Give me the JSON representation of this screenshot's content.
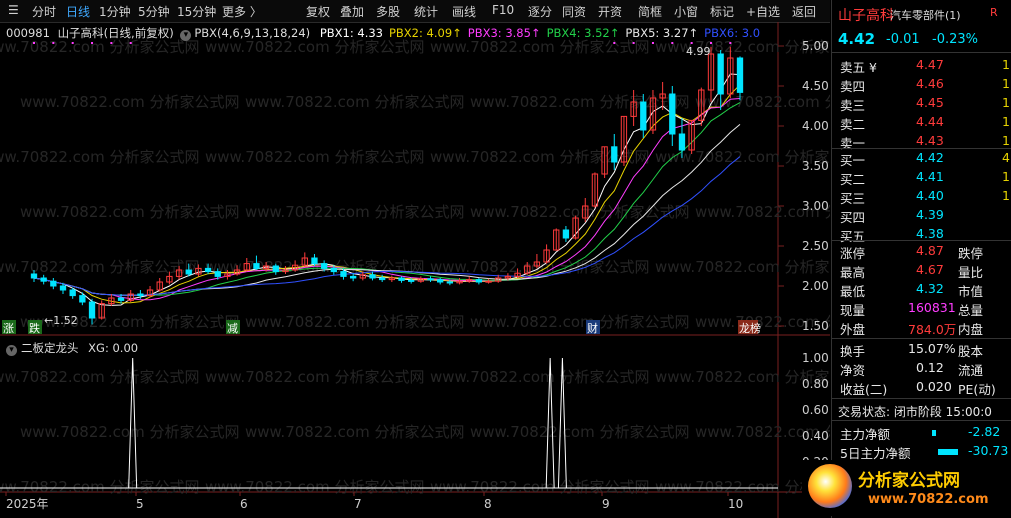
{
  "toolbar": {
    "left_items": [
      "分时",
      "日线",
      "1分钟",
      "5分钟",
      "15分钟",
      "更多 〉"
    ],
    "active": "日线",
    "right_items": [
      "复权",
      "叠加",
      "多股",
      "统计",
      "画线",
      "F10",
      "逐分",
      "同资",
      "开资",
      "简框",
      "小窗",
      "标记",
      "+自选",
      "返回"
    ]
  },
  "stock": {
    "code": "000981",
    "name": "山子高科",
    "period_label": "(日线,前复权)",
    "industry": "汽车零部件(1)",
    "indicator": "PBX(4,6,9,13,18,24)",
    "pbx": [
      {
        "label": "PBX1: 4.33",
        "color": "#ffffff"
      },
      {
        "label": "PBX2: 4.09↑",
        "color": "#e6d200"
      },
      {
        "label": "PBX3: 3.85↑",
        "color": "#ff3dff"
      },
      {
        "label": "PBX4: 3.52↑",
        "color": "#22d04a"
      },
      {
        "label": "PBX5: 3.27↑",
        "color": "#e8e8e8"
      },
      {
        "label": "PBX6: 3.0",
        "color": "#3050ff"
      }
    ],
    "watermark": "www.70822.com 分析家公式网"
  },
  "price_axis": [
    "5.00",
    "4.50",
    "4.00",
    "3.50",
    "3.00",
    "2.50",
    "2.00",
    "1.50"
  ],
  "annotations": {
    "high": "4.99",
    "low": "←1.52"
  },
  "markers": [
    "涨",
    "跌",
    "减",
    "财",
    "龙榜"
  ],
  "sub_indicator": {
    "title": "二板定龙头",
    "value_label": "XG: 0.00",
    "axis": [
      "1.00",
      "0.80",
      "0.60",
      "0.40",
      "0.20"
    ]
  },
  "chart_data": {
    "type": "candlestick",
    "ylim": [
      1.4,
      5.1
    ],
    "x_labels": [
      "2025年",
      "5",
      "6",
      "7",
      "8",
      "9",
      "10"
    ],
    "candles": [
      [
        2.15,
        2.1,
        2.2,
        2.05
      ],
      [
        2.1,
        2.06,
        2.14,
        2.02
      ],
      [
        2.06,
        2.0,
        2.1,
        1.96
      ],
      [
        2.0,
        1.95,
        2.04,
        1.9
      ],
      [
        1.95,
        1.88,
        1.98,
        1.84
      ],
      [
        1.88,
        1.8,
        1.92,
        1.76
      ],
      [
        1.8,
        1.6,
        1.84,
        1.52
      ],
      [
        1.6,
        1.78,
        1.82,
        1.58
      ],
      [
        1.78,
        1.85,
        1.9,
        1.75
      ],
      [
        1.85,
        1.82,
        1.9,
        1.78
      ],
      [
        1.82,
        1.9,
        1.95,
        1.8
      ],
      [
        1.9,
        1.88,
        1.95,
        1.84
      ],
      [
        1.88,
        1.95,
        2.0,
        1.86
      ],
      [
        1.95,
        2.05,
        2.1,
        1.93
      ],
      [
        2.05,
        2.12,
        2.18,
        2.02
      ],
      [
        2.12,
        2.2,
        2.25,
        2.08
      ],
      [
        2.2,
        2.15,
        2.28,
        2.12
      ],
      [
        2.15,
        2.22,
        2.27,
        2.12
      ],
      [
        2.22,
        2.18,
        2.28,
        2.15
      ],
      [
        2.18,
        2.12,
        2.22,
        2.08
      ],
      [
        2.12,
        2.15,
        2.2,
        2.08
      ],
      [
        2.15,
        2.2,
        2.26,
        2.13
      ],
      [
        2.2,
        2.28,
        2.35,
        2.18
      ],
      [
        2.28,
        2.22,
        2.38,
        2.2
      ],
      [
        2.22,
        2.25,
        2.3,
        2.18
      ],
      [
        2.25,
        2.18,
        2.28,
        2.14
      ],
      [
        2.18,
        2.2,
        2.25,
        2.15
      ],
      [
        2.2,
        2.26,
        2.32,
        2.18
      ],
      [
        2.26,
        2.35,
        2.42,
        2.24
      ],
      [
        2.35,
        2.28,
        2.4,
        2.25
      ],
      [
        2.28,
        2.22,
        2.32,
        2.18
      ],
      [
        2.22,
        2.18,
        2.26,
        2.14
      ],
      [
        2.18,
        2.12,
        2.22,
        2.08
      ],
      [
        2.12,
        2.1,
        2.16,
        2.06
      ],
      [
        2.1,
        2.14,
        2.18,
        2.07
      ],
      [
        2.14,
        2.1,
        2.18,
        2.07
      ],
      [
        2.1,
        2.08,
        2.14,
        2.05
      ],
      [
        2.08,
        2.1,
        2.13,
        2.05
      ],
      [
        2.1,
        2.07,
        2.12,
        2.04
      ],
      [
        2.07,
        2.06,
        2.1,
        2.03
      ],
      [
        2.06,
        2.09,
        2.12,
        2.04
      ],
      [
        2.09,
        2.08,
        2.12,
        2.05
      ],
      [
        2.08,
        2.05,
        2.1,
        2.02
      ],
      [
        2.05,
        2.04,
        2.08,
        2.01
      ],
      [
        2.04,
        2.06,
        2.1,
        2.02
      ],
      [
        2.06,
        2.08,
        2.12,
        2.04
      ],
      [
        2.08,
        2.05,
        2.1,
        2.02
      ],
      [
        2.05,
        2.06,
        2.09,
        2.03
      ],
      [
        2.06,
        2.1,
        2.14,
        2.04
      ],
      [
        2.1,
        2.12,
        2.16,
        2.07
      ],
      [
        2.12,
        2.16,
        2.22,
        2.1
      ],
      [
        2.16,
        2.25,
        2.3,
        2.14
      ],
      [
        2.25,
        2.3,
        2.4,
        2.22
      ],
      [
        2.3,
        2.45,
        2.52,
        2.28
      ],
      [
        2.45,
        2.7,
        2.72,
        2.44
      ],
      [
        2.7,
        2.6,
        2.75,
        2.55
      ],
      [
        2.6,
        2.85,
        2.88,
        2.58
      ],
      [
        2.85,
        3.0,
        3.1,
        2.8
      ],
      [
        3.0,
        3.4,
        3.42,
        2.98
      ],
      [
        3.4,
        3.74,
        3.74,
        3.35
      ],
      [
        3.74,
        3.55,
        3.9,
        3.45
      ],
      [
        3.55,
        4.12,
        4.12,
        3.5
      ],
      [
        4.12,
        4.3,
        4.45,
        4.0
      ],
      [
        4.3,
        3.95,
        4.4,
        3.85
      ],
      [
        3.95,
        4.35,
        4.45,
        3.9
      ],
      [
        4.35,
        4.4,
        4.55,
        4.2
      ],
      [
        4.4,
        3.9,
        4.5,
        3.75
      ],
      [
        3.9,
        3.7,
        4.1,
        3.6
      ],
      [
        3.7,
        4.07,
        4.07,
        3.65
      ],
      [
        4.07,
        4.45,
        4.48,
        4.0
      ],
      [
        4.45,
        4.9,
        4.99,
        4.3
      ],
      [
        4.9,
        4.4,
        4.95,
        4.2
      ],
      [
        4.4,
        4.85,
        4.99,
        4.35
      ],
      [
        4.85,
        4.42,
        4.87,
        4.32
      ]
    ],
    "xg_peaks": [
      0.168,
      0.713,
      0.729
    ]
  },
  "quote": {
    "price": "4.42",
    "change": "-0.01",
    "change_pct": "-0.23%",
    "asks": [
      {
        "label": "卖五 ¥",
        "price": "4.47",
        "vol": "1"
      },
      {
        "label": "卖四",
        "price": "4.46",
        "vol": "1"
      },
      {
        "label": "卖三",
        "price": "4.45",
        "vol": "1"
      },
      {
        "label": "卖二",
        "price": "4.44",
        "vol": "1"
      },
      {
        "label": "卖一",
        "price": "4.43",
        "vol": "1"
      }
    ],
    "bids": [
      {
        "label": "买一",
        "price": "4.42",
        "vol": "4"
      },
      {
        "label": "买二",
        "price": "4.41",
        "vol": "1"
      },
      {
        "label": "买三",
        "price": "4.40",
        "vol": "1"
      },
      {
        "label": "买四",
        "price": "4.39",
        "vol": ""
      },
      {
        "label": "买五",
        "price": "4.38",
        "vol": ""
      }
    ],
    "stats1": [
      {
        "k": "涨停",
        "v": "4.87",
        "vc": "red",
        "k2": "跌停"
      },
      {
        "k": "最高",
        "v": "4.67",
        "vc": "red",
        "k2": "量比"
      },
      {
        "k": "最低",
        "v": "4.32",
        "vc": "cyan",
        "k2": "市值"
      },
      {
        "k": "现量",
        "v": "160831",
        "vc": "mag",
        "k2": "总量"
      },
      {
        "k": "外盘",
        "v": "784.0万",
        "vc": "red",
        "k2": "内盘"
      }
    ],
    "stats2": [
      {
        "k": "换手",
        "v": "15.07%",
        "k2": "股本"
      },
      {
        "k": "净资",
        "v": "0.12",
        "k2": "流通"
      },
      {
        "k": "收益(二)",
        "v": "0.020",
        "k2": "PE(动)"
      }
    ],
    "status_label": "交易状态: 闭市阶段 15:00:0",
    "flows": [
      {
        "k": "主力净额",
        "v": "-2.82"
      },
      {
        "k": "5日主力净额",
        "v": "-30.73"
      }
    ],
    "logo_text": "分析家公式网",
    "logo_url": "www.70822.com"
  }
}
